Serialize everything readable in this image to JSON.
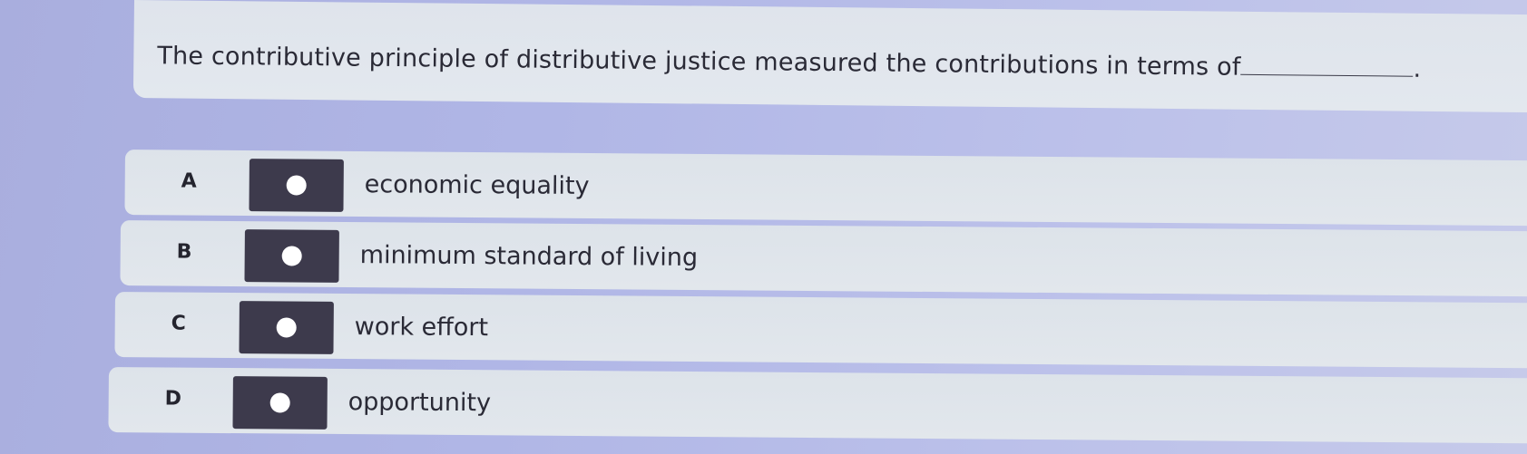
{
  "question": {
    "text": "The contributive principle of distributive justice measured the contributions in terms of",
    "suffix": "."
  },
  "options": [
    {
      "letter": "A",
      "label": "economic equality",
      "selected": false
    },
    {
      "letter": "B",
      "label": "minimum standard of living",
      "selected": false
    },
    {
      "letter": "C",
      "label": "work effort",
      "selected": false
    },
    {
      "letter": "D",
      "label": "opportunity",
      "selected": false
    }
  ]
}
